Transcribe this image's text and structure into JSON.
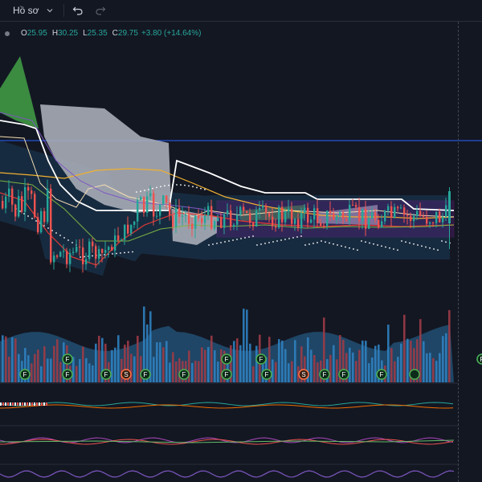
{
  "toolbar": {
    "profile_label": "Hồ sơ",
    "icons": [
      "chevron-down-icon",
      "undo-icon",
      "redo-icon"
    ]
  },
  "legend": {
    "open_key": "O",
    "open": "25.95",
    "high_key": "H",
    "high": "30.25",
    "low_key": "L",
    "low": "25.35",
    "close_key": "C",
    "close": "29.75",
    "change": "+3.80 (+14.64%)"
  },
  "colors": {
    "background": "#131722",
    "up": "#26a69a",
    "down": "#ef5350",
    "cloud_bull": "#43a047",
    "cloud_bear": "#b2b5be",
    "band_fill": "#1c3d5a",
    "volume_up": "#2f7fbf",
    "volume_down": "#9c3b47",
    "horizontal_line": "#2962ff"
  },
  "markers": {
    "row_upper": [
      "F",
      "F",
      "F",
      "●",
      "F"
    ],
    "row_lower": [
      "F",
      "F",
      "F",
      "S",
      "F",
      "F",
      "F",
      "F",
      "S",
      "F",
      "F",
      "F"
    ]
  }
}
